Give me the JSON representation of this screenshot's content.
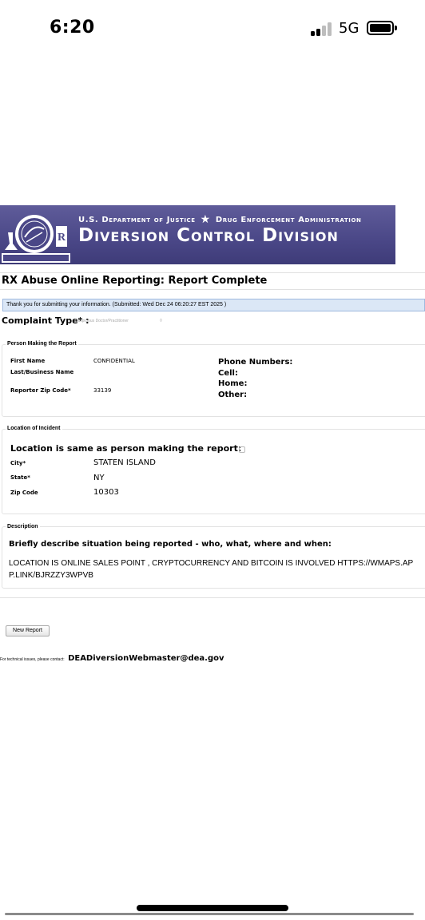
{
  "status_bar": {
    "time": "6:20",
    "network": "5G"
  },
  "banner": {
    "top_left": "U.S. Department of Justice",
    "top_right": "Drug Enforcement Administration",
    "title": "Diversion Control Division",
    "seal_text": "Diversion Control Division"
  },
  "page": {
    "title": "RX Abuse Online Reporting: Report Complete",
    "confirmation": "Thank you for submitting your information. (Submitted: Wed Dec 24 06:20:27 EST 2025 )",
    "complaint_type_label": "Complaint Type* :",
    "complaint_type_value": "Suspicious Doctor/Practitioner"
  },
  "reporter": {
    "legend": "Person Making the Report",
    "first_name_label": "First Name",
    "first_name_value": "CONFIDENTIAL",
    "last_name_label": "Last/Business Name",
    "zip_label": "Reporter Zip Code*",
    "zip_value": "33139",
    "phone_numbers_label": "Phone Numbers:",
    "cell_label": "Cell:",
    "home_label": "Home:",
    "other_label": "Other:"
  },
  "location": {
    "legend": "Location of Incident",
    "same_label": "Location is same as person making the report:",
    "city_label": "City*",
    "city_value": "STATEN ISLAND",
    "state_label": "State*",
    "state_value": "NY",
    "zip_label": "Zip Code",
    "zip_value": "10303"
  },
  "description": {
    "legend": "Description",
    "prompt": "Briefly describe situation being reported - who, what, where and when:",
    "text_line1": "LOCATION IS ONLINE SALES POINT , CRYPTOCURRENCY AND BITCOIN IS INVOLVED HTTPS://WMAPS.AP",
    "text_line2": "P.LINK/BJRZZY3WPVB"
  },
  "footer": {
    "new_report_label": "New Report",
    "contact_prefix": "For technical issues, please contact:",
    "contact_email": "DEADiversionWebmaster@dea.gov"
  }
}
